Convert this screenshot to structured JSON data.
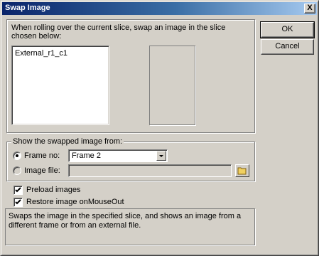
{
  "window": {
    "title": "Swap Image",
    "close_glyph": "X"
  },
  "slice_group": {
    "instruction": "When rolling over the current slice, swap an image in the slice chosen below:",
    "slices": [
      "External_r1_c1"
    ]
  },
  "buttons": {
    "ok": "OK",
    "cancel": "Cancel"
  },
  "source_group": {
    "legend": "Show the swapped image from:",
    "frame_option": {
      "label": "Frame no:",
      "selected": true
    },
    "frame_select": {
      "value": "Frame 2"
    },
    "image_file_option": {
      "label": "Image file:",
      "selected": false
    },
    "image_file_value": ""
  },
  "options": {
    "preload": {
      "label": "Preload images",
      "checked": true
    },
    "restore": {
      "label": "Restore image onMouseOut",
      "checked": true
    }
  },
  "description": "Swaps the image in the specified slice, and shows an image from a different frame or from an external file.",
  "icons": {
    "close": "close-icon",
    "dropdown": "chevron-down-icon",
    "folder": "folder-icon",
    "check": "check-icon"
  }
}
